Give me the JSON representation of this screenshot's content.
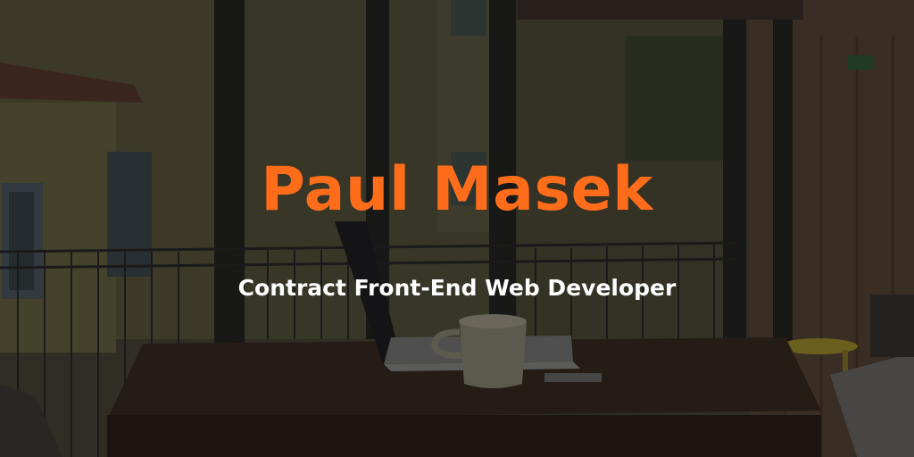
{
  "hero": {
    "name": "Paul Masek",
    "tagline": "Contract Front-End Web Developer"
  },
  "colors": {
    "accent": "#ff6d1a",
    "text": "#ffffff"
  }
}
